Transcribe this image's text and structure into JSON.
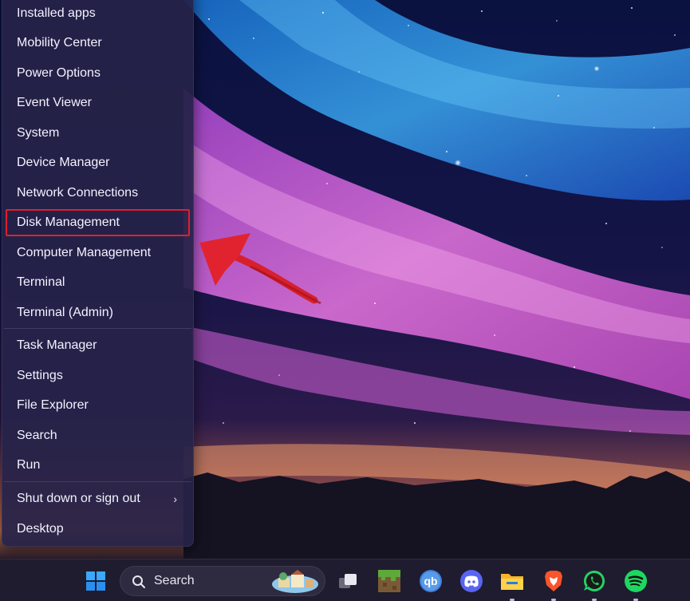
{
  "menu": {
    "items": [
      {
        "label": "Installed apps"
      },
      {
        "label": "Mobility Center"
      },
      {
        "label": "Power Options"
      },
      {
        "label": "Event Viewer"
      },
      {
        "label": "System"
      },
      {
        "label": "Device Manager"
      },
      {
        "label": "Network Connections"
      },
      {
        "label": "Disk Management",
        "highlighted": true
      },
      {
        "label": "Computer Management"
      },
      {
        "label": "Terminal"
      },
      {
        "label": "Terminal (Admin)"
      },
      {
        "label": "Task Manager"
      },
      {
        "label": "Settings"
      },
      {
        "label": "File Explorer"
      },
      {
        "label": "Search"
      },
      {
        "label": "Run"
      },
      {
        "label": "Shut down or sign out",
        "has_submenu": true
      },
      {
        "label": "Desktop"
      }
    ],
    "highlight_color": "#e01f2d"
  },
  "taskbar": {
    "search_label": "Search",
    "apps": [
      {
        "icon": "start-windows-icon"
      },
      {
        "icon": "task-view-icon"
      },
      {
        "icon": "minecraft-icon"
      },
      {
        "icon": "qbittorrent-icon",
        "label": "qb"
      },
      {
        "icon": "discord-icon"
      },
      {
        "icon": "file-explorer-icon"
      },
      {
        "icon": "brave-browser-icon"
      },
      {
        "icon": "whatsapp-icon"
      },
      {
        "icon": "spotify-icon"
      }
    ]
  }
}
